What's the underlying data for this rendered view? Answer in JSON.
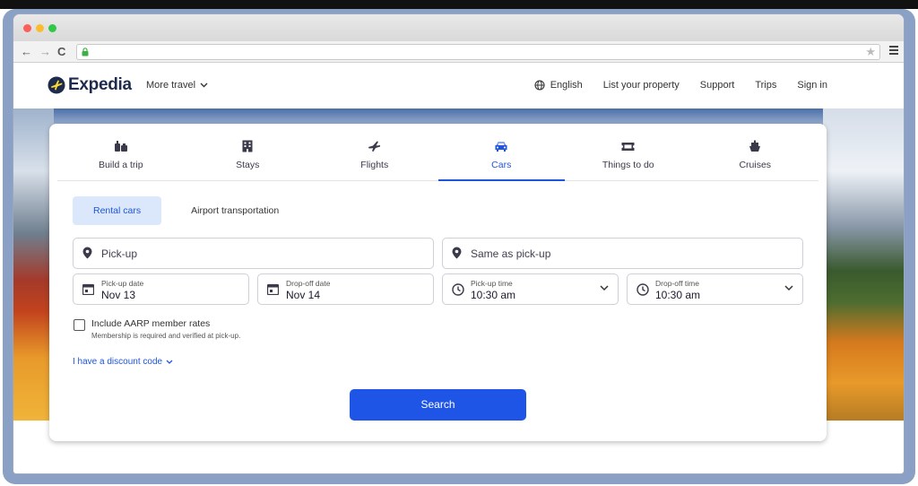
{
  "browser": {
    "back_glyph": "←",
    "forward_glyph": "→",
    "reload_glyph": "C",
    "star_glyph": "★",
    "url": ""
  },
  "header": {
    "logo_text": "Expedia",
    "more_travel": "More travel",
    "language": "English",
    "list_property": "List your property",
    "support": "Support",
    "trips": "Trips",
    "sign_in": "Sign in"
  },
  "tabs": [
    {
      "label": "Build a trip",
      "icon": "build-trip-icon"
    },
    {
      "label": "Stays",
      "icon": "building-icon"
    },
    {
      "label": "Flights",
      "icon": "plane-icon"
    },
    {
      "label": "Cars",
      "icon": "car-icon",
      "active": true
    },
    {
      "label": "Things to do",
      "icon": "ticket-icon"
    },
    {
      "label": "Cruises",
      "icon": "ship-icon"
    }
  ],
  "pills": {
    "rental_cars": "Rental cars",
    "airport_transportation": "Airport transportation"
  },
  "form": {
    "pickup_placeholder": "Pick-up",
    "dropoff_placeholder": "Same as pick-up",
    "pickup_date_label": "Pick-up date",
    "pickup_date_value": "Nov 13",
    "dropoff_date_label": "Drop-off date",
    "dropoff_date_value": "Nov 14",
    "pickup_time_label": "Pick-up time",
    "pickup_time_value": "10:30 am",
    "dropoff_time_label": "Drop-off time",
    "dropoff_time_value": "10:30 am",
    "aarp_label": "Include AARP member rates",
    "aarp_sub": "Membership is required and verified at pick-up.",
    "discount_code": "I have a discount code",
    "search_button": "Search"
  },
  "colors": {
    "accent": "#1f55e6",
    "active_tab": "#1f55d8",
    "pill_active_bg": "#dbe8fb",
    "logo_dark": "#1f2b4d",
    "logo_yellow": "#fddb32"
  }
}
